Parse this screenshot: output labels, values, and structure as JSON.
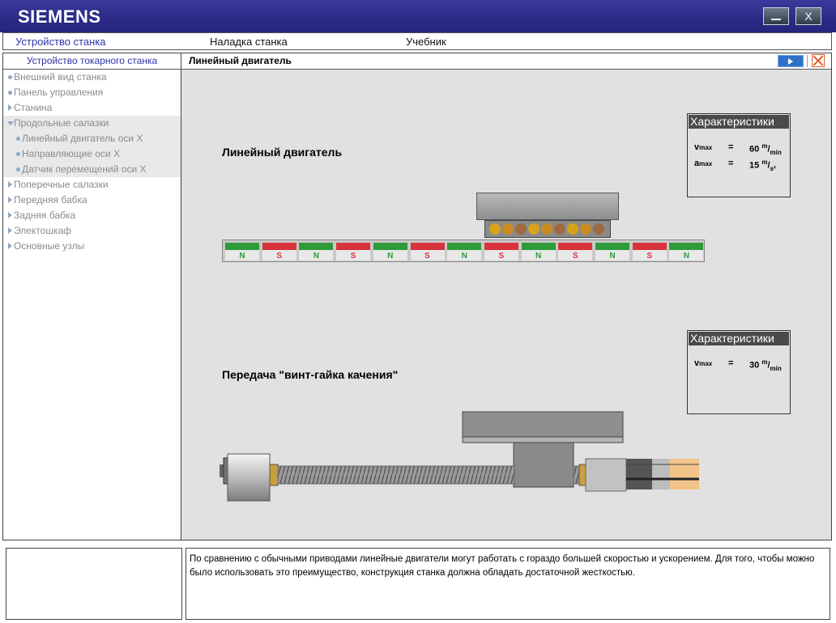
{
  "app": {
    "logo": "SIEMENS",
    "close_label": "X"
  },
  "menu": {
    "items": [
      "Устройство станка",
      "Наладка станка",
      "Учебник"
    ]
  },
  "sidebar": {
    "header": "Устройство токарного станка",
    "items": [
      {
        "label": "Внешний вид станка",
        "icon": "bullet-icon"
      },
      {
        "label": "Панель управления",
        "icon": "bullet-icon"
      },
      {
        "label": "Станина",
        "icon": "expand-arrow-icon"
      },
      {
        "label": "Продольные салазки",
        "icon": "collapse-arrow-icon"
      },
      {
        "label": "Линейный двигатель оси X",
        "icon": "bullet-icon"
      },
      {
        "label": "Направляющие оси X",
        "icon": "bullet-icon"
      },
      {
        "label": "Датчик перемещений оси X",
        "icon": "bullet-icon"
      },
      {
        "label": "Поперечные салазки",
        "icon": "expand-arrow-icon"
      },
      {
        "label": "Передняя бабка",
        "icon": "expand-arrow-icon"
      },
      {
        "label": "Задняя бабка",
        "icon": "expand-arrow-icon"
      },
      {
        "label": "Электошкаф",
        "icon": "expand-arrow-icon"
      },
      {
        "label": "Основные узлы",
        "icon": "expand-arrow-icon"
      }
    ]
  },
  "content": {
    "title": "Линейный двигатель",
    "linear": {
      "heading": "Линейный двигатель",
      "box_title": "Характеристики",
      "v_sym": "v",
      "v_sub": "max",
      "v_eq": "=",
      "v_val": "60",
      "v_unit_num": "m",
      "v_unit_den": "min",
      "a_sym": "a",
      "a_sub": "max",
      "a_eq": "=",
      "a_val": "15",
      "a_unit_num": "m",
      "a_unit_den": "s²",
      "poles": [
        "N",
        "S",
        "N",
        "S",
        "N",
        "S",
        "N",
        "S",
        "N",
        "S",
        "N",
        "S",
        "N"
      ]
    },
    "ballscrew": {
      "heading": "Передача \"винт-гайка качения\"",
      "box_title": "Характеристики",
      "v_sym": "v",
      "v_sub": "max",
      "v_eq": "=",
      "v_val": "30",
      "v_unit_num": "m",
      "v_unit_den": "min"
    }
  },
  "footer": {
    "text": "По сравнению с обычными приводами линейные двигатели могут работать с гораздо большей скоростью и ускорением. Для того, чтобы можно было использовать это преимущество, конструкция станка должна обладать достаточной жесткостью."
  },
  "colors": {
    "north": "#2e9a3a",
    "south": "#d8333b",
    "title_bar": "#2a2a86",
    "accent": "#2d35a8"
  }
}
